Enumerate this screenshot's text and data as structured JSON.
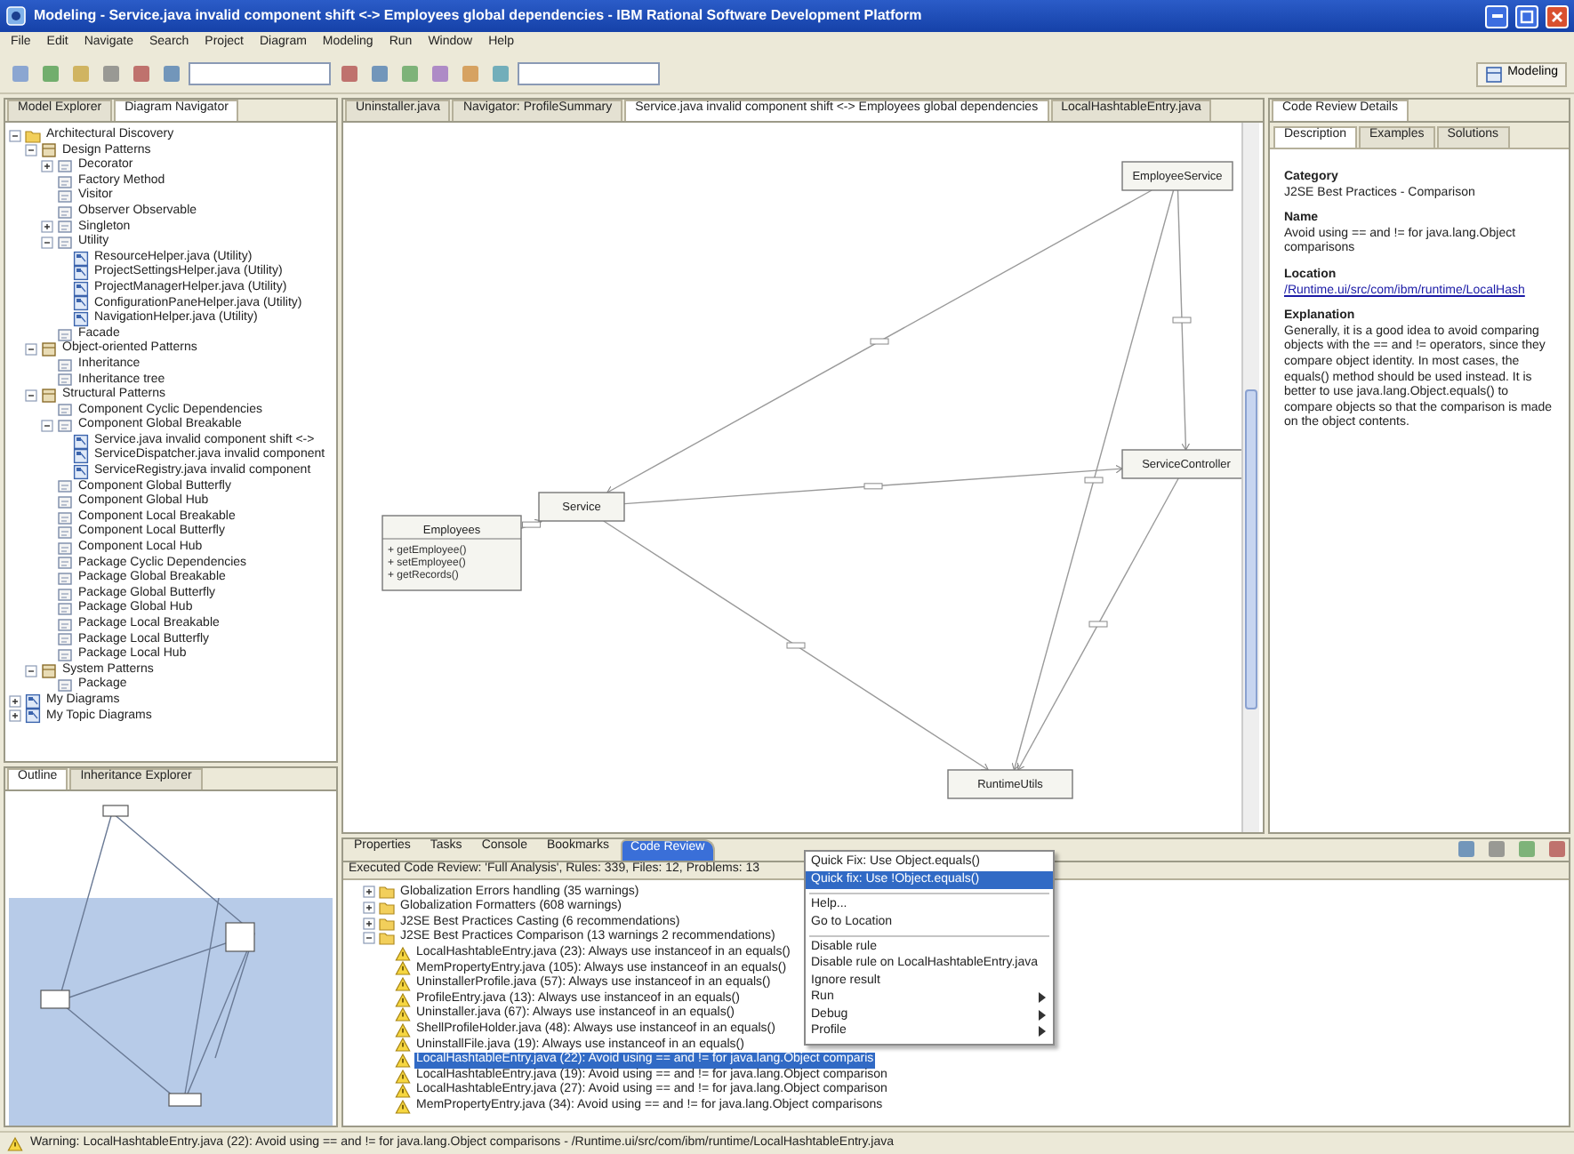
{
  "window": {
    "title": "Modeling - Service.java invalid component shift <-> Employees global dependencies - IBM Rational Software Development Platform"
  },
  "menu": [
    "File",
    "Edit",
    "Navigate",
    "Search",
    "Project",
    "Diagram",
    "Modeling",
    "Run",
    "Window",
    "Help"
  ],
  "toolbar": {
    "perspective": "Modeling"
  },
  "left_view": {
    "tabs": [
      {
        "label": "Model Explorer",
        "selected": false
      },
      {
        "label": "Diagram Navigator",
        "selected": true
      }
    ],
    "tree": [
      {
        "label": "Architectural Discovery",
        "kind": "folder",
        "expanded": true,
        "children": [
          {
            "label": "Design Patterns",
            "kind": "package",
            "expanded": true,
            "children": [
              {
                "label": "Decorator",
                "kind": "pattern",
                "expanded": false
              },
              {
                "label": "Factory Method",
                "kind": "pattern"
              },
              {
                "label": "Visitor",
                "kind": "pattern"
              },
              {
                "label": "Observer Observable",
                "kind": "pattern"
              },
              {
                "label": "Singleton",
                "kind": "pattern",
                "expanded": false
              },
              {
                "label": "Utility",
                "kind": "pattern",
                "expanded": true,
                "children": [
                  {
                    "label": "ResourceHelper.java (Utility)",
                    "kind": "diagram"
                  },
                  {
                    "label": "ProjectSettingsHelper.java (Utility)",
                    "kind": "diagram"
                  },
                  {
                    "label": "ProjectManagerHelper.java (Utility)",
                    "kind": "diagram"
                  },
                  {
                    "label": "ConfigurationPaneHelper.java (Utility)",
                    "kind": "diagram"
                  },
                  {
                    "label": "NavigationHelper.java (Utility)",
                    "kind": "diagram"
                  }
                ]
              },
              {
                "label": "Facade",
                "kind": "pattern"
              }
            ]
          },
          {
            "label": "Object-oriented Patterns",
            "kind": "package",
            "expanded": true,
            "children": [
              {
                "label": "Inheritance",
                "kind": "pattern"
              },
              {
                "label": "Inheritance tree",
                "kind": "pattern"
              }
            ]
          },
          {
            "label": "Structural Patterns",
            "kind": "package",
            "expanded": true,
            "children": [
              {
                "label": "Component Cyclic Dependencies",
                "kind": "pattern"
              },
              {
                "label": "Component Global Breakable",
                "kind": "pattern",
                "expanded": true,
                "children": [
                  {
                    "label": "Service.java invalid component shift <->",
                    "kind": "diagram"
                  },
                  {
                    "label": "ServiceDispatcher.java invalid component",
                    "kind": "diagram"
                  },
                  {
                    "label": "ServiceRegistry.java invalid component",
                    "kind": "diagram"
                  }
                ]
              },
              {
                "label": "Component Global Butterfly",
                "kind": "pattern"
              },
              {
                "label": "Component Global Hub",
                "kind": "pattern"
              },
              {
                "label": "Component Local Breakable",
                "kind": "pattern"
              },
              {
                "label": "Component Local Butterfly",
                "kind": "pattern"
              },
              {
                "label": "Component Local Hub",
                "kind": "pattern"
              },
              {
                "label": "Package Cyclic Dependencies",
                "kind": "pattern"
              },
              {
                "label": "Package Global Breakable",
                "kind": "pattern"
              },
              {
                "label": "Package Global Butterfly",
                "kind": "pattern"
              },
              {
                "label": "Package Global Hub",
                "kind": "pattern"
              },
              {
                "label": "Package Local Breakable",
                "kind": "pattern"
              },
              {
                "label": "Package Local Butterfly",
                "kind": "pattern"
              },
              {
                "label": "Package Local Hub",
                "kind": "pattern"
              }
            ]
          },
          {
            "label": "System Patterns",
            "kind": "package",
            "expanded": true,
            "children": [
              {
                "label": "Package",
                "kind": "pattern"
              }
            ]
          }
        ]
      },
      {
        "label": "My Diagrams",
        "kind": "diagram",
        "expanded": false
      },
      {
        "label": "My Topic Diagrams",
        "kind": "diagram",
        "expanded": false
      }
    ]
  },
  "outline": {
    "tabs": [
      {
        "label": "Outline",
        "selected": true
      },
      {
        "label": "Inheritance Explorer",
        "selected": false
      }
    ]
  },
  "editor": {
    "tabs": [
      {
        "label": "Uninstaller.java",
        "selected": false
      },
      {
        "label": "Navigator: ProfileSummary",
        "selected": false
      },
      {
        "label": "Service.java invalid component shift <-> Employees global dependencies",
        "selected": true
      },
      {
        "label": "LocalHashtableEntry.java",
        "selected": false
      }
    ],
    "nodes": [
      {
        "name": "EmployeeService"
      },
      {
        "name": "ServiceController"
      },
      {
        "name": "RuntimeUtils"
      },
      {
        "name": "Service"
      },
      {
        "name": "Employees",
        "members": [
          "+ getEmployee()",
          "+ setEmployee()",
          "+ getRecords()"
        ]
      }
    ]
  },
  "details": {
    "title": "Code Review Details",
    "tabs": [
      {
        "label": "Description",
        "selected": true
      },
      {
        "label": "Examples",
        "selected": false
      },
      {
        "label": "Solutions",
        "selected": false
      }
    ],
    "sections": [
      {
        "heading": "Category",
        "kind": "text",
        "text": "J2SE Best Practices - Comparison"
      },
      {
        "heading": "Name",
        "kind": "text",
        "text": "Avoid using == and != for java.lang.Object comparisons"
      },
      {
        "heading": "Location",
        "kind": "link",
        "text": "/Runtime.ui/src/com/ibm/runtime/LocalHash"
      },
      {
        "heading": "Explanation",
        "kind": "text",
        "text": "Generally, it is a good idea to avoid comparing objects with the == and != operators, since they compare object identity. In most cases, the equals() method should be used instead. It is better to use java.lang.Object.equals() to compare objects so that the comparison is made on the object contents."
      }
    ]
  },
  "bottom": {
    "tabs": [
      {
        "label": "Properties",
        "selected": false
      },
      {
        "label": "Tasks",
        "selected": false
      },
      {
        "label": "Console",
        "selected": false
      },
      {
        "label": "Bookmarks",
        "selected": false
      },
      {
        "label": "Code Review",
        "selected": true
      }
    ],
    "summary": "Executed Code Review: 'Full Analysis', Rules: 339, Files: 12, Problems: 13",
    "results": [
      {
        "label": "Globalization Errors handling (35 warnings)",
        "kind": "folder",
        "expanded": false,
        "selected": false
      },
      {
        "label": "Globalization Formatters (608 warnings)",
        "kind": "folder",
        "expanded": false,
        "selected": false
      },
      {
        "label": "J2SE Best Practices Casting (6 recommendations)",
        "kind": "folder",
        "expanded": false,
        "selected": false
      },
      {
        "label": "J2SE Best Practices Comparison (13 warnings 2 recommendations)",
        "kind": "folder",
        "expanded": true,
        "selected": false,
        "children": [
          {
            "label": "LocalHashtableEntry.java (23): Always use instanceof in an equals()",
            "kind": "warning",
            "selected": false
          },
          {
            "label": "MemPropertyEntry.java (105): Always use instanceof in an equals()",
            "kind": "warning",
            "selected": false
          },
          {
            "label": "UninstallerProfile.java (57): Always use instanceof in an equals()",
            "kind": "warning",
            "selected": false
          },
          {
            "label": "ProfileEntry.java (13): Always use instanceof in an equals()",
            "kind": "warning",
            "selected": false
          },
          {
            "label": "Uninstaller.java (67): Always use instanceof in an equals()",
            "kind": "warning",
            "selected": false
          },
          {
            "label": "ShellProfileHolder.java (48): Always use instanceof in an equals()",
            "kind": "warning",
            "selected": false
          },
          {
            "label": "UninstallFile.java (19): Always use instanceof in an equals()",
            "kind": "warning",
            "selected": false
          },
          {
            "label": "LocalHashtableEntry.java (22): Avoid using == and != for java.lang.Object comparis",
            "kind": "warning",
            "selected": true
          },
          {
            "label": "LocalHashtableEntry.java (19): Avoid using == and != for java.lang.Object comparison",
            "kind": "warning",
            "selected": false
          },
          {
            "label": "LocalHashtableEntry.java (27): Avoid using == and != for java.lang.Object comparison",
            "kind": "warning",
            "selected": false
          },
          {
            "label": "MemPropertyEntry.java (34): Avoid using == and != for java.lang.Object comparisons",
            "kind": "warning",
            "selected": false
          }
        ]
      }
    ],
    "context_menu": [
      {
        "label": "Quick Fix: Use Object.equals()",
        "kind": "item",
        "selected": false
      },
      {
        "label": "Quick fix: Use !Object.equals()",
        "kind": "item",
        "selected": true
      },
      {
        "kind": "separator"
      },
      {
        "label": "Help...",
        "kind": "item",
        "selected": false
      },
      {
        "label": "Go to Location",
        "kind": "item",
        "selected": false
      },
      {
        "kind": "separator"
      },
      {
        "label": "Disable rule",
        "kind": "item",
        "selected": false
      },
      {
        "label": "Disable rule on LocalHashtableEntry.java",
        "kind": "item",
        "selected": false
      },
      {
        "label": "Ignore result",
        "kind": "item",
        "selected": false
      },
      {
        "label": "Run",
        "kind": "submenu",
        "selected": false
      },
      {
        "label": "Debug",
        "kind": "submenu",
        "selected": false
      },
      {
        "label": "Profile",
        "kind": "submenu",
        "selected": false
      }
    ]
  },
  "status_bar": "Warning: LocalHashtableEntry.java (22): Avoid using == and != for java.lang.Object comparisons - /Runtime.ui/src/com/ibm/runtime/LocalHashtableEntry.java"
}
